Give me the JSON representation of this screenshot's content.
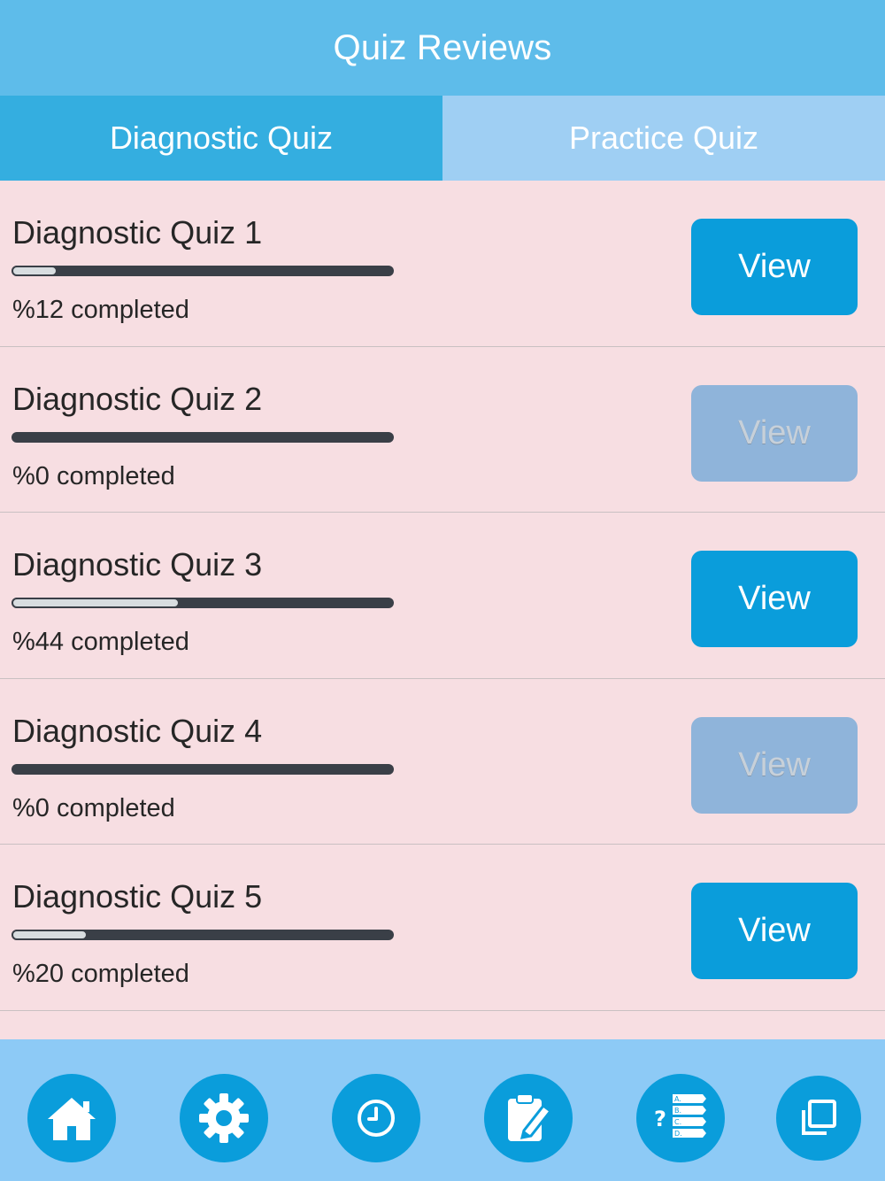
{
  "header": {
    "title": "Quiz Reviews"
  },
  "tabs": [
    {
      "label": "Diagnostic Quiz",
      "active": true
    },
    {
      "label": "Practice Quiz",
      "active": false
    }
  ],
  "quizzes": [
    {
      "title": "Diagnostic Quiz 1",
      "progress": 0.12,
      "status": "%12 completed",
      "button": "View",
      "enabled": true
    },
    {
      "title": "Diagnostic Quiz 2",
      "progress": 0.0,
      "status": "%0 completed",
      "button": "View",
      "enabled": false
    },
    {
      "title": "Diagnostic Quiz 3",
      "progress": 0.44,
      "status": "%44 completed",
      "button": "View",
      "enabled": true
    },
    {
      "title": "Diagnostic Quiz 4",
      "progress": 0.0,
      "status": "%0 completed",
      "button": "View",
      "enabled": false
    },
    {
      "title": "Diagnostic Quiz 5",
      "progress": 0.2,
      "status": "%20 completed",
      "button": "View",
      "enabled": true
    }
  ],
  "bottom_nav": [
    {
      "icon": "home-icon"
    },
    {
      "icon": "gear-icon"
    },
    {
      "icon": "clock-icon"
    },
    {
      "icon": "clipboard-edit-icon"
    },
    {
      "icon": "quiz-options-icon"
    },
    {
      "icon": "copy-windows-icon"
    }
  ],
  "colors": {
    "header_bg": "#5ebcea",
    "tab_active_bg": "#34aee0",
    "tab_inactive_bg": "#9fcff3",
    "list_bg": "#f7dee2",
    "button_enabled": "#0a9ddb",
    "button_disabled": "#8fb4da",
    "bottom_bar_bg": "#8dcaf6"
  }
}
